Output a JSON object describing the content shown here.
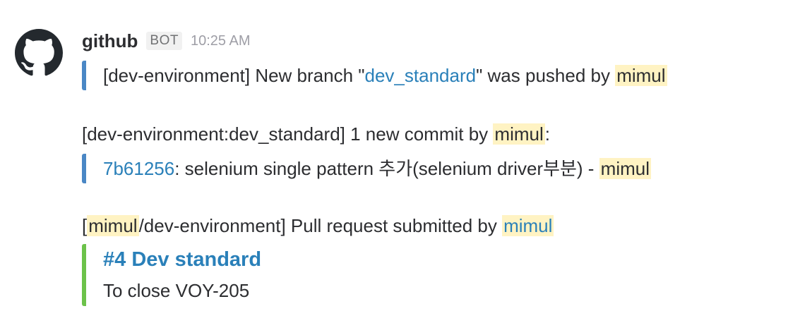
{
  "message": {
    "sender": "github",
    "badge": "BOT",
    "time": "10:25 AM",
    "avatar_icon": "github-octocat-icon"
  },
  "branch_push": {
    "prefix": "[dev-environment] New branch \"",
    "branch": "dev_standard",
    "middle": "\" was pushed by ",
    "user": "mimul"
  },
  "commit_summary": {
    "prefix": "[dev-environment:dev_standard] 1 new commit by ",
    "user": "mimul",
    "suffix": ":"
  },
  "commit": {
    "hash": "7b61256",
    "message": ": selenium single pattern 추가(selenium driver부분) - ",
    "author": "mimul"
  },
  "pull_request": {
    "open_bracket": "[",
    "owner": "mimul",
    "repo_suffix": "/dev-environment] Pull request submitted by ",
    "submitter": "mimul",
    "title": "#4 Dev standard",
    "body": "To close VOY-205"
  },
  "colors": {
    "link": "#2a80b9",
    "mention_highlight": "#fff3c3",
    "quote_bar_blue": "#4a87c5",
    "attachment_bar_green": "#6cc24a"
  }
}
